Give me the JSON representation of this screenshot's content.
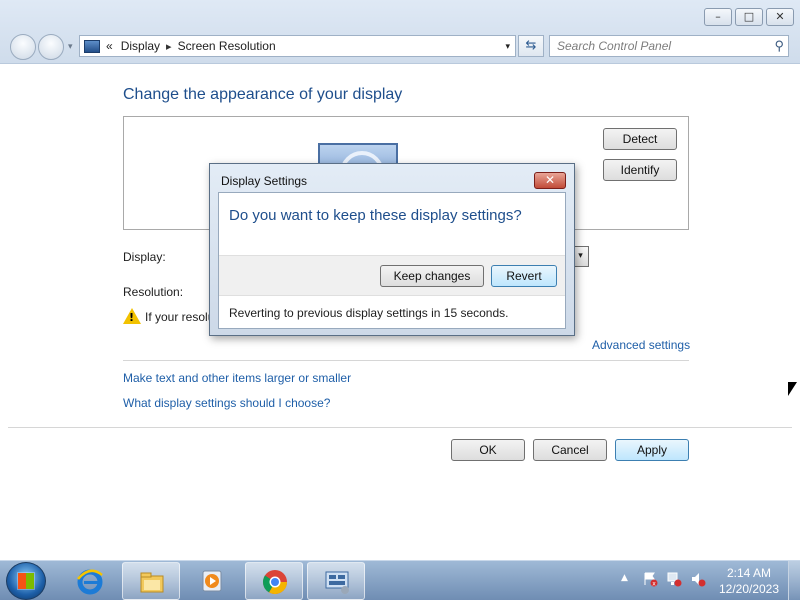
{
  "window": {
    "caption_buttons": {
      "minimize": "–",
      "maximize": "□",
      "close": "✕"
    },
    "address": {
      "crumbs": [
        "Display",
        "Screen Resolution"
      ],
      "chevron": "«",
      "separator": "▸",
      "dropdown": "▾"
    },
    "search": {
      "placeholder": "Search Control Panel",
      "icon": "magnifier-icon",
      "glyph": "⚲"
    },
    "refresh_glyph": "⇆"
  },
  "main": {
    "title": "Change the appearance of your display",
    "buttons": {
      "detect": "Detect",
      "identify": "Identify"
    },
    "display_label": "Display:",
    "resolution_label": "Resolution:",
    "warning_text": "If your resolu",
    "warning_glyph": "!",
    "display_dropdown_glyph": "▾",
    "advanced_link": "Advanced settings",
    "links": [
      "Make text and other items larger or smaller",
      "What display settings should I choose?"
    ],
    "footer_buttons": {
      "ok": "OK",
      "cancel": "Cancel",
      "apply": "Apply"
    }
  },
  "dialog": {
    "title": "Display Settings",
    "close_glyph": "✕",
    "question": "Do you want to keep these display settings?",
    "keep": "Keep changes",
    "revert": "Revert",
    "message": "Reverting to previous display settings in 15 seconds."
  },
  "taskbar": {
    "items": [
      "internet-explorer-icon",
      "file-explorer-icon",
      "media-player-icon",
      "chrome-icon",
      "control-panel-icon"
    ],
    "tray_arrow": "▲",
    "time": "2:14 AM",
    "date": "12/20/2023"
  },
  "colors": {
    "accent": "#1e4e8c",
    "link": "#1f5fa8",
    "taskbar": "#6f8db3"
  }
}
